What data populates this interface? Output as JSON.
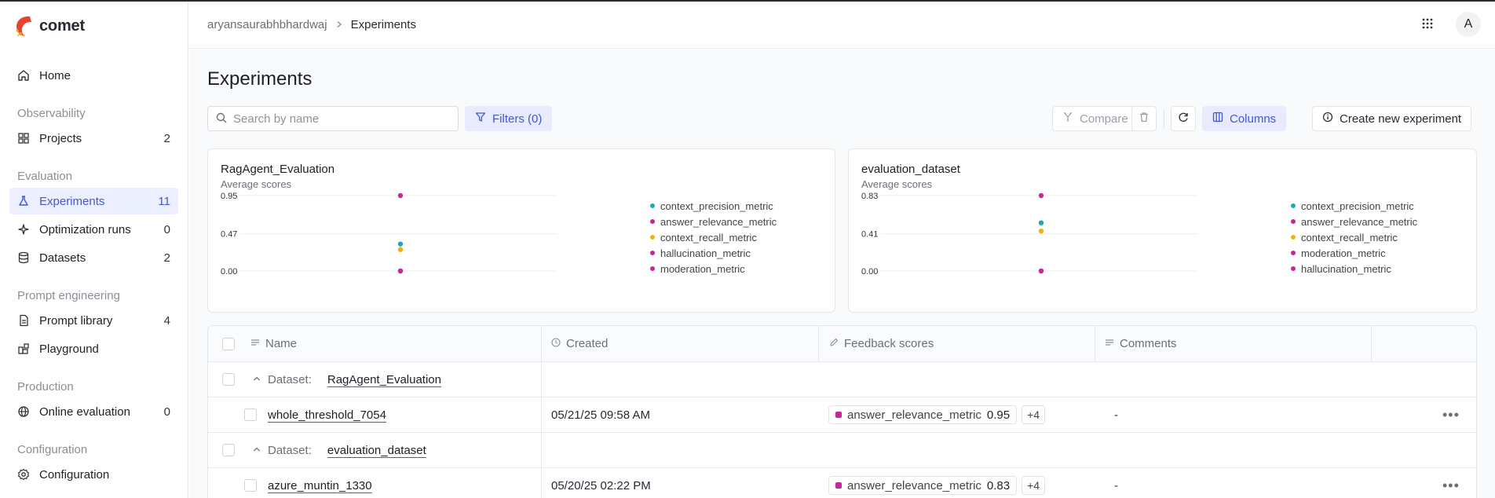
{
  "app": {
    "name": "comet"
  },
  "sidebar": {
    "home": "Home",
    "sections": {
      "observability": "Observability",
      "evaluation": "Evaluation",
      "prompt_engineering": "Prompt engineering",
      "production": "Production",
      "configuration": "Configuration"
    },
    "items": [
      {
        "label": "Projects",
        "count": "2"
      },
      {
        "label": "Experiments",
        "count": "11"
      },
      {
        "label": "Optimization runs",
        "count": "0"
      },
      {
        "label": "Datasets",
        "count": "2"
      },
      {
        "label": "Prompt library",
        "count": "4"
      },
      {
        "label": "Playground",
        "count": ""
      },
      {
        "label": "Online evaluation",
        "count": "0"
      },
      {
        "label": "Configuration",
        "count": ""
      }
    ],
    "active": "Experiments"
  },
  "header": {
    "breadcrumb": [
      "aryansaurabhbhardwaj",
      "Experiments"
    ],
    "avatar_initial": "A"
  },
  "page": {
    "title": "Experiments",
    "search_placeholder": "Search by name",
    "filters_label": "Filters (0)",
    "compare_label": "Compare",
    "columns_label": "Columns",
    "create_label": "Create new experiment"
  },
  "colors": {
    "accent": "#4457d6",
    "teal": "#1ea7b5",
    "magenta": "#c22a9a",
    "amber": "#f2b20e"
  },
  "chart_data": [
    {
      "type": "scatter",
      "title": "RagAgent_Evaluation",
      "subtitle": "Average scores",
      "y_ticks": [
        "0.95",
        "0.47",
        "0.00"
      ],
      "ylim": [
        0,
        0.95
      ],
      "series": [
        {
          "name": "context_precision_metric",
          "color": "#1ea7b5",
          "value": 0.34
        },
        {
          "name": "answer_relevance_metric",
          "color": "#c22a9a",
          "value": 0.95
        },
        {
          "name": "context_recall_metric",
          "color": "#f2b20e",
          "value": 0.27
        },
        {
          "name": "hallucination_metric",
          "color": "#c22a9a",
          "value": 0.0
        },
        {
          "name": "moderation_metric",
          "color": "#c22a9a",
          "value": 0.0
        }
      ]
    },
    {
      "type": "scatter",
      "title": "evaluation_dataset",
      "subtitle": "Average scores",
      "y_ticks": [
        "0.83",
        "0.41",
        "0.00"
      ],
      "ylim": [
        0,
        0.83
      ],
      "series": [
        {
          "name": "context_precision_metric",
          "color": "#1ea7b5",
          "value": 0.53
        },
        {
          "name": "answer_relevance_metric",
          "color": "#c22a9a",
          "value": 0.83
        },
        {
          "name": "context_recall_metric",
          "color": "#f2b20e",
          "value": 0.44
        },
        {
          "name": "moderation_metric",
          "color": "#c22a9a",
          "value": 0.0
        },
        {
          "name": "hallucination_metric",
          "color": "#c22a9a",
          "value": 0.0
        }
      ]
    }
  ],
  "table": {
    "columns": [
      "Name",
      "Created",
      "Feedback scores",
      "Comments"
    ],
    "dataset_label": "Dataset:",
    "groups": [
      {
        "dataset": "RagAgent_Evaluation",
        "rows": [
          {
            "name": "whole_threshold_7054",
            "created": "05/21/25 09:58 AM",
            "score_name": "answer_relevance_metric",
            "score_value": "0.95",
            "more": "+4",
            "comments": "-"
          }
        ]
      },
      {
        "dataset": "evaluation_dataset",
        "rows": [
          {
            "name": "azure_muntin_1330",
            "created": "05/20/25 02:22 PM",
            "score_name": "answer_relevance_metric",
            "score_value": "0.83",
            "more": "+4",
            "comments": "-"
          }
        ]
      }
    ]
  }
}
